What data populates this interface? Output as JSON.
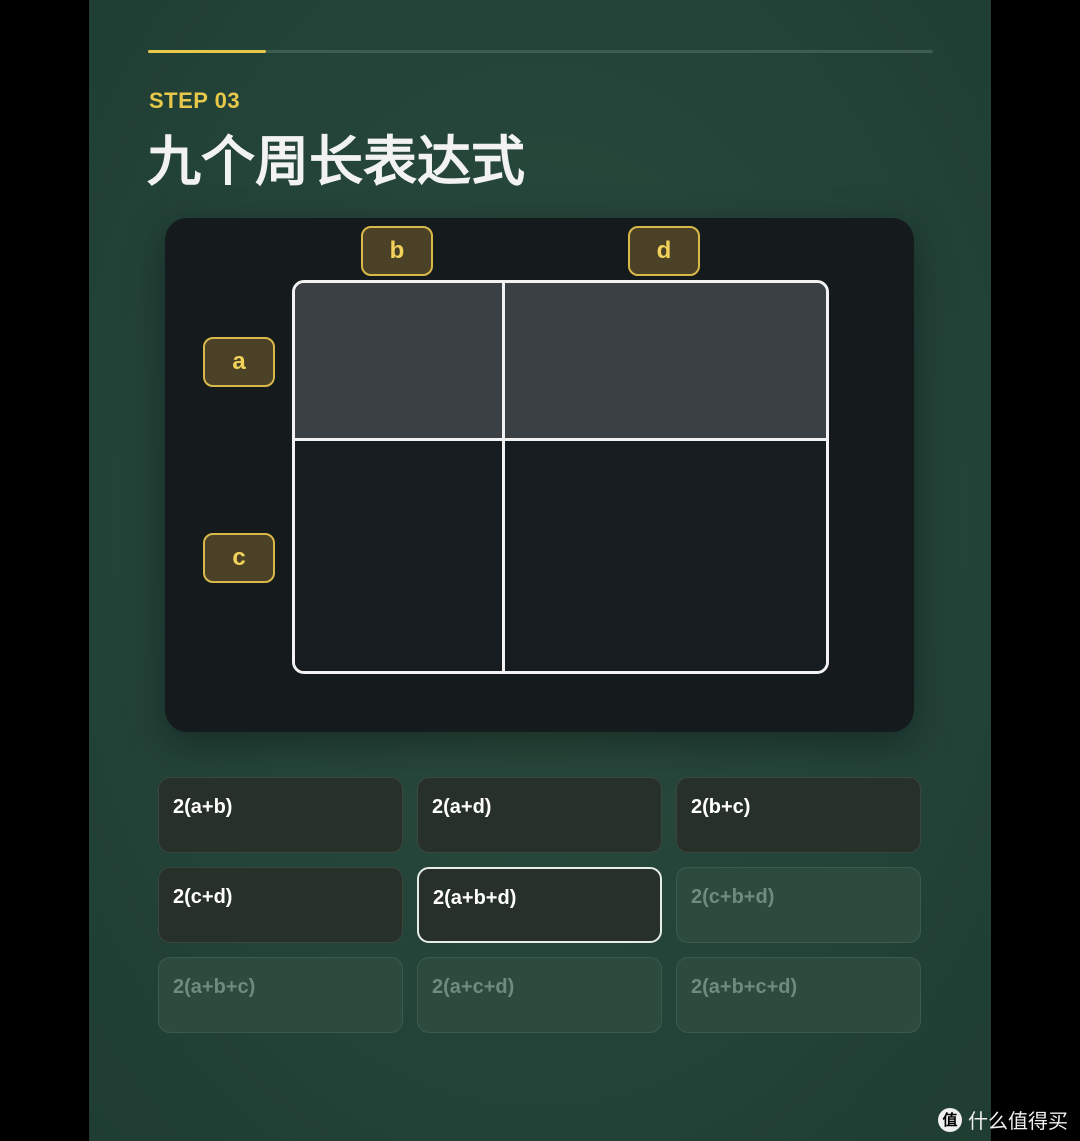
{
  "progress": {
    "fraction": 0.15,
    "color": "#e8c84a"
  },
  "step": {
    "label": "STEP 03"
  },
  "title": "九个周长表达式",
  "diagram": {
    "top_labels": [
      "b",
      "d"
    ],
    "left_labels": [
      "a",
      "c"
    ]
  },
  "options": [
    {
      "text": "2(a+b)",
      "state": "on"
    },
    {
      "text": "2(a+d)",
      "state": "on"
    },
    {
      "text": "2(b+c)",
      "state": "on"
    },
    {
      "text": "2(c+d)",
      "state": "on"
    },
    {
      "text": "2(a+b+d)",
      "state": "selected"
    },
    {
      "text": "2(c+b+d)",
      "state": "off"
    },
    {
      "text": "2(a+b+c)",
      "state": "off"
    },
    {
      "text": "2(a+c+d)",
      "state": "off"
    },
    {
      "text": "2(a+b+c+d)",
      "state": "off"
    }
  ],
  "watermark": {
    "icon": "值",
    "text": "什么值得买"
  },
  "colors": {
    "accent": "#e8c84a",
    "background": "#24443a"
  }
}
